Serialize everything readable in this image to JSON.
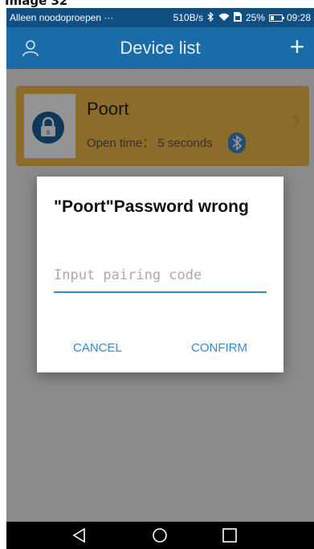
{
  "caption": {
    "text": "Image 32"
  },
  "status_bar": {
    "carrier": "Alleen noodoproepen ···",
    "speed": "510B/s",
    "battery_percent": "25%",
    "time": "09:28"
  },
  "header": {
    "title": "Device list",
    "add_symbol": "+"
  },
  "device": {
    "name": "Poort",
    "open_time": "Open time： 5 seconds",
    "lock_letter": "s"
  },
  "dialog": {
    "title": "\"Poort\"Password wrong",
    "input": {
      "placeholder": "Input pairing code",
      "value": ""
    },
    "cancel_label": "CANCEL",
    "confirm_label": "CONFIRM"
  },
  "colors": {
    "status_bar": "#0f4f83",
    "header": "#1a6ca9",
    "accent": "#2f8ad4",
    "card": "#f2b84b",
    "lock": "#1b5f9a"
  },
  "icons": {
    "user": "user-icon",
    "add": "plus-icon",
    "lock": "lock-icon",
    "bluetooth": "bluetooth-icon",
    "chevron": "chevron-right-icon",
    "nav_back": "back-triangle-icon",
    "nav_home": "home-circle-icon",
    "nav_recents": "recents-square-icon"
  }
}
